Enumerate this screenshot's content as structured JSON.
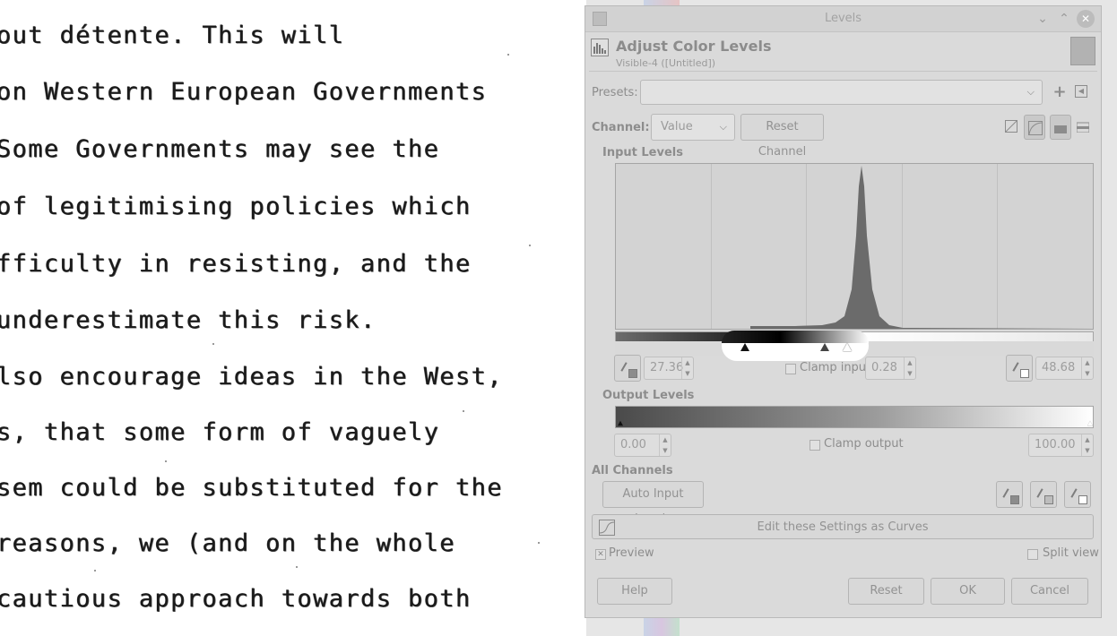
{
  "document": {
    "lines": [
      "out détente.  This will",
      "on Western European Governments",
      "Some Governments may see the",
      "of legitimising policies which",
      "fficulty in resisting, and the",
      " underestimate this risk.",
      "lso encourage ideas in the West,",
      "s, that some form of vaguely",
      "sem could be substituted for the",
      " reasons, we (and on the whole",
      " cautious approach towards both"
    ]
  },
  "dialog": {
    "window_title": "Levels",
    "header_title": "Adjust Color Levels",
    "header_subtitle": "Visible-4 ([Untitled])",
    "presets": {
      "label": "Presets:",
      "value": ""
    },
    "channel": {
      "label": "Channel:",
      "value": "Value",
      "reset_label": "Reset Channel"
    },
    "input_levels": {
      "label": "Input Levels",
      "low": "27.36",
      "gamma": "0.28",
      "high": "48.68",
      "clamp_label": "Clamp input",
      "clamp_checked": false
    },
    "output_levels": {
      "label": "Output Levels",
      "low": "0.00",
      "high": "100.00",
      "clamp_label": "Clamp output",
      "clamp_checked": false
    },
    "all_channels": {
      "label": "All Channels",
      "auto_label": "Auto Input Levels"
    },
    "curves_label": "Edit these Settings as Curves",
    "preview": {
      "label": "Preview",
      "checked": true
    },
    "split_view": {
      "label": "Split view",
      "checked": false
    },
    "buttons": {
      "help": "Help",
      "reset": "Reset",
      "ok": "OK",
      "cancel": "Cancel"
    }
  },
  "icons": {
    "minimize": "chevron-down-icon",
    "maximize": "chevron-up-icon",
    "close": "close-icon",
    "add_preset": "plus-icon",
    "preset_menu": "menu-arrow-icon"
  },
  "colors": {
    "dialog_bg": "#dadada",
    "histogram_fill": "#6b6b6b",
    "text_dim": "#8d8d8d"
  }
}
